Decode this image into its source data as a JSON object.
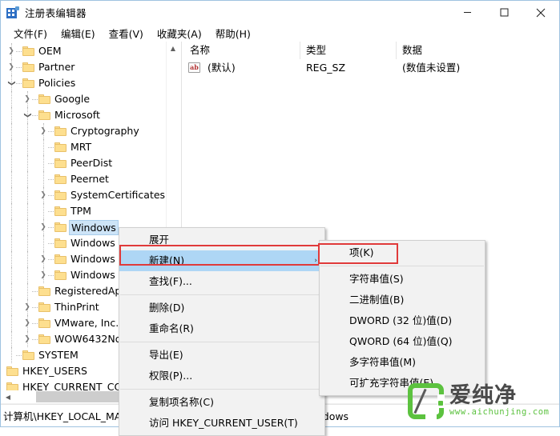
{
  "window": {
    "title": "注册表编辑器",
    "icon": "registry-editor-icon",
    "controls": {
      "minimize": "—",
      "maximize": "□",
      "close": "✕"
    }
  },
  "menubar": {
    "items": [
      {
        "label": "文件(F)"
      },
      {
        "label": "编辑(E)"
      },
      {
        "label": "查看(V)"
      },
      {
        "label": "收藏夹(A)"
      },
      {
        "label": "帮助(H)"
      }
    ]
  },
  "tree": {
    "nodes": [
      {
        "label": "OEM",
        "depth": 1,
        "chevron": "collapsed",
        "selected": false
      },
      {
        "label": "Partner",
        "depth": 1,
        "chevron": "collapsed",
        "selected": false
      },
      {
        "label": "Policies",
        "depth": 1,
        "chevron": "expanded",
        "selected": false
      },
      {
        "label": "Google",
        "depth": 2,
        "chevron": "collapsed",
        "selected": false
      },
      {
        "label": "Microsoft",
        "depth": 2,
        "chevron": "expanded",
        "selected": false
      },
      {
        "label": "Cryptography",
        "depth": 3,
        "chevron": "collapsed",
        "selected": false
      },
      {
        "label": "MRT",
        "depth": 3,
        "chevron": "none",
        "selected": false
      },
      {
        "label": "PeerDist",
        "depth": 3,
        "chevron": "none",
        "selected": false
      },
      {
        "label": "Peernet",
        "depth": 3,
        "chevron": "none",
        "selected": false
      },
      {
        "label": "SystemCertificates",
        "depth": 3,
        "chevron": "collapsed",
        "selected": false
      },
      {
        "label": "TPM",
        "depth": 3,
        "chevron": "none",
        "selected": false
      },
      {
        "label": "Windows",
        "depth": 3,
        "chevron": "collapsed",
        "selected": true
      },
      {
        "label": "Windows",
        "depth": 3,
        "chevron": "none",
        "selected": false
      },
      {
        "label": "Windows",
        "depth": 3,
        "chevron": "collapsed",
        "selected": false
      },
      {
        "label": "Windows",
        "depth": 3,
        "chevron": "collapsed",
        "selected": false
      },
      {
        "label": "RegisteredApp",
        "depth": 2,
        "chevron": "none",
        "selected": false
      },
      {
        "label": "ThinPrint",
        "depth": 2,
        "chevron": "collapsed",
        "selected": false
      },
      {
        "label": "VMware, Inc.",
        "depth": 2,
        "chevron": "collapsed",
        "selected": false
      },
      {
        "label": "WOW6432Nod",
        "depth": 2,
        "chevron": "collapsed",
        "selected": false
      },
      {
        "label": "SYSTEM",
        "depth": 1,
        "chevron": "none",
        "selected": false
      },
      {
        "label": "HKEY_USERS",
        "depth": 0,
        "chevron": "none",
        "selected": false
      },
      {
        "label": "HKEY_CURRENT_CON",
        "depth": 0,
        "chevron": "none",
        "selected": false
      }
    ]
  },
  "listview": {
    "columns": [
      {
        "label": "名称"
      },
      {
        "label": "类型"
      },
      {
        "label": "数据"
      }
    ],
    "rows": [
      {
        "name": "(默认)",
        "type": "REG_SZ",
        "data": "(数值未设置)",
        "icon": "ab-string-icon"
      }
    ]
  },
  "context_menu": {
    "items": [
      {
        "label": "展开",
        "highlighted": false,
        "submenu": false,
        "separator_after": false
      },
      {
        "label": "新建(N)",
        "highlighted": true,
        "submenu": true,
        "separator_after": false
      },
      {
        "label": "查找(F)...",
        "highlighted": false,
        "submenu": false,
        "separator_after": true
      },
      {
        "label": "删除(D)",
        "highlighted": false,
        "submenu": false,
        "separator_after": false
      },
      {
        "label": "重命名(R)",
        "highlighted": false,
        "submenu": false,
        "separator_after": true
      },
      {
        "label": "导出(E)",
        "highlighted": false,
        "submenu": false,
        "separator_after": false
      },
      {
        "label": "权限(P)...",
        "highlighted": false,
        "submenu": false,
        "separator_after": true
      },
      {
        "label": "复制项名称(C)",
        "highlighted": false,
        "submenu": false,
        "separator_after": false
      },
      {
        "label": "访问 HKEY_CURRENT_USER(T)",
        "highlighted": false,
        "submenu": false,
        "separator_after": false
      }
    ],
    "submenu_arrow": "›"
  },
  "submenu": {
    "items": [
      {
        "label": "项(K)",
        "annotated": true
      },
      {
        "label": "字符串值(S)",
        "annotated": false
      },
      {
        "label": "二进制值(B)",
        "annotated": false
      },
      {
        "label": "DWORD (32 位)值(D)",
        "annotated": false
      },
      {
        "label": "QWORD (64 位)值(Q)",
        "annotated": false
      },
      {
        "label": "多字符串值(M)",
        "annotated": false
      },
      {
        "label": "可扩充字符串值(E)",
        "annotated": false
      }
    ]
  },
  "statusbar": {
    "path": "计算机\\HKEY_LOCAL_MACHINE\\SOFTWARE\\Policies\\Microsoft\\Windows"
  },
  "watermark": {
    "brand": "爱纯净",
    "url": "www.aichunjing.com"
  },
  "colors": {
    "selection_blue": "#cde4f7",
    "menu_highlight": "#aed6f5",
    "annotation_red": "#e03a3a",
    "folder_yellow": "#fddf8f",
    "brand_green": "#5cc23f",
    "window_border": "#9fc3e0"
  }
}
